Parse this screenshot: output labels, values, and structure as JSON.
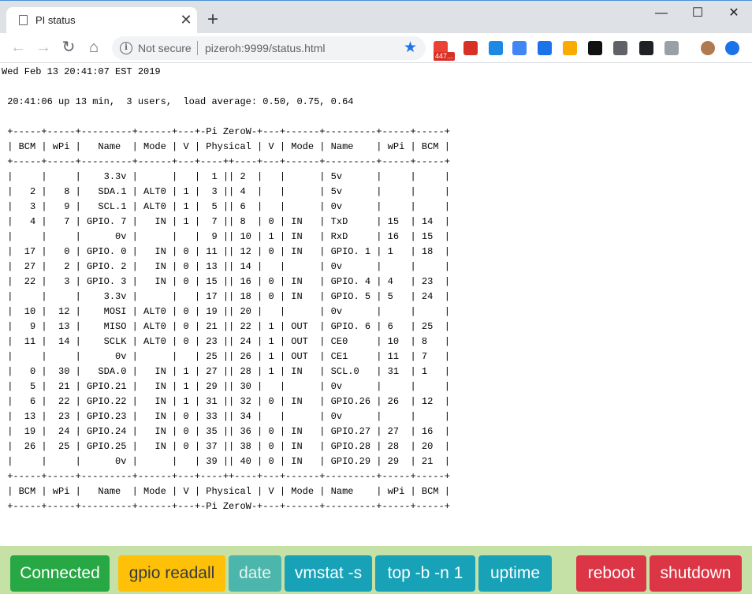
{
  "browser": {
    "tab_title": "PI status",
    "tab_close": "✕",
    "new_tab": "+",
    "window_controls": {
      "minimize": "—",
      "maximize": "☐",
      "close": "✕"
    },
    "security_label": "Not secure",
    "url": "pizeroh:9999/status.html",
    "extensions": [
      {
        "name": "gmail-icon",
        "color": "#ea4335",
        "badge": "447..."
      },
      {
        "name": "dots-icon",
        "color": "#d93025"
      },
      {
        "name": "m-circle-icon",
        "color": "#1e88e5"
      },
      {
        "name": "translate-icon",
        "color": "#4285f4"
      },
      {
        "name": "chat-bubble-icon",
        "color": "#1a73e8"
      },
      {
        "name": "sticky-note-icon",
        "color": "#f9ab00"
      },
      {
        "name": "diamond-arrows-icon",
        "color": "#111111"
      },
      {
        "name": "link-icon",
        "color": "#5f6368"
      },
      {
        "name": "compass-icon",
        "color": "#202124"
      },
      {
        "name": "v-logo-icon",
        "color": "#9aa0a6"
      },
      {
        "name": "avatar-icon",
        "color": "#b07a4f"
      },
      {
        "name": "upload-icon",
        "color": "#1a73e8"
      }
    ]
  },
  "page": {
    "lines": [
      "Wed Feb 13 20:41:07 EST 2019",
      "",
      " 20:41:06 up 13 min,  3 users,  load average: 0.50, 0.75, 0.64",
      "",
      " +-----+-----+---------+------+---+-Pi ZeroW-+---+------+---------+-----+-----+",
      " | BCM | wPi |   Name  | Mode | V | Physical | V | Mode | Name    | wPi | BCM |",
      " +-----+-----+---------+------+---+----++----+---+------+---------+-----+-----+",
      " |     |     |    3.3v |      |   |  1 || 2  |   |      | 5v      |     |     |",
      " |   2 |   8 |   SDA.1 | ALT0 | 1 |  3 || 4  |   |      | 5v      |     |     |",
      " |   3 |   9 |   SCL.1 | ALT0 | 1 |  5 || 6  |   |      | 0v      |     |     |",
      " |   4 |   7 | GPIO. 7 |   IN | 1 |  7 || 8  | 0 | IN   | TxD     | 15  | 14  |",
      " |     |     |      0v |      |   |  9 || 10 | 1 | IN   | RxD     | 16  | 15  |",
      " |  17 |   0 | GPIO. 0 |   IN | 0 | 11 || 12 | 0 | IN   | GPIO. 1 | 1   | 18  |",
      " |  27 |   2 | GPIO. 2 |   IN | 0 | 13 || 14 |   |      | 0v      |     |     |",
      " |  22 |   3 | GPIO. 3 |   IN | 0 | 15 || 16 | 0 | IN   | GPIO. 4 | 4   | 23  |",
      " |     |     |    3.3v |      |   | 17 || 18 | 0 | IN   | GPIO. 5 | 5   | 24  |",
      " |  10 |  12 |    MOSI | ALT0 | 0 | 19 || 20 |   |      | 0v      |     |     |",
      " |   9 |  13 |    MISO | ALT0 | 0 | 21 || 22 | 1 | OUT  | GPIO. 6 | 6   | 25  |",
      " |  11 |  14 |    SCLK | ALT0 | 0 | 23 || 24 | 1 | OUT  | CE0     | 10  | 8   |",
      " |     |     |      0v |      |   | 25 || 26 | 1 | OUT  | CE1     | 11  | 7   |",
      " |   0 |  30 |   SDA.0 |   IN | 1 | 27 || 28 | 1 | IN   | SCL.0   | 31  | 1   |",
      " |   5 |  21 | GPIO.21 |   IN | 1 | 29 || 30 |   |      | 0v      |     |     |",
      " |   6 |  22 | GPIO.22 |   IN | 1 | 31 || 32 | 0 | IN   | GPIO.26 | 26  | 12  |",
      " |  13 |  23 | GPIO.23 |   IN | 0 | 33 || 34 |   |      | 0v      |     |     |",
      " |  19 |  24 | GPIO.24 |   IN | 0 | 35 || 36 | 0 | IN   | GPIO.27 | 27  | 16  |",
      " |  26 |  25 | GPIO.25 |   IN | 0 | 37 || 38 | 0 | IN   | GPIO.28 | 28  | 20  |",
      " |     |     |      0v |      |   | 39 || 40 | 0 | IN   | GPIO.29 | 29  | 21  |",
      " +-----+-----+---------+------+---+----++----+---+------+---------+-----+-----+",
      " | BCM | wPi |   Name  | Mode | V | Physical | V | Mode | Name    | wPi | BCM |",
      " +-----+-----+---------+------+---+-Pi ZeroW-+---+------+---------+-----+-----+"
    ]
  },
  "buttons": {
    "connected": {
      "label": "Connected",
      "bg": "#28a745",
      "fg": "#ffffff"
    },
    "gpio_readall": {
      "label": "gpio readall",
      "bg": "#ffc107",
      "fg": "#343a40"
    },
    "date": {
      "label": "date",
      "bg": "#4db6ac",
      "fg": "#e6f4f2"
    },
    "vmstat": {
      "label": "vmstat -s",
      "bg": "#17a2b8",
      "fg": "#ffffff"
    },
    "top": {
      "label": "top -b -n 1",
      "bg": "#17a2b8",
      "fg": "#ffffff"
    },
    "uptime": {
      "label": "uptime",
      "bg": "#17a2b8",
      "fg": "#ffffff"
    },
    "reboot": {
      "label": "reboot",
      "bg": "#dc3545",
      "fg": "#ffffff"
    },
    "shutdown": {
      "label": "shutdown",
      "bg": "#dc3545",
      "fg": "#ffffff"
    }
  }
}
